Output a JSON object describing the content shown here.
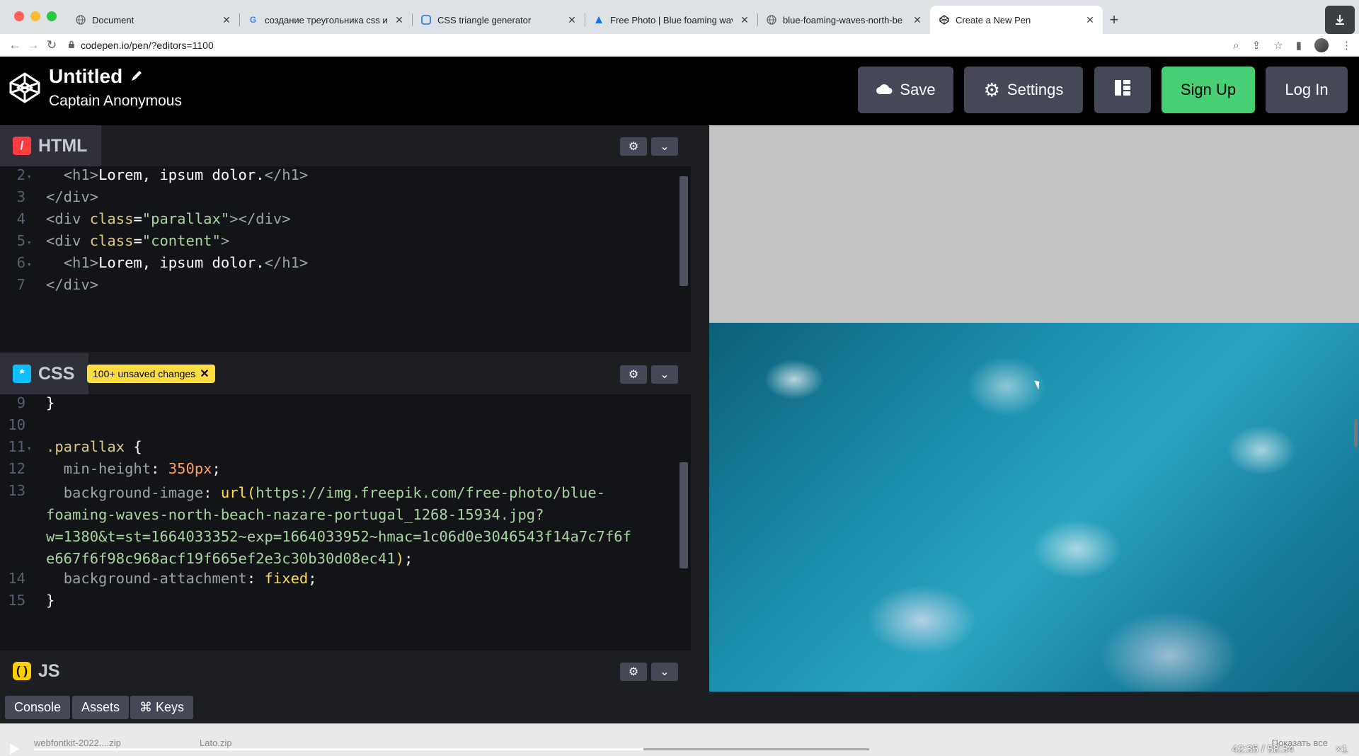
{
  "browser": {
    "tabs": [
      {
        "title": "Document",
        "favicon": "globe-icon",
        "active": false
      },
      {
        "title": "создание треугольника css и",
        "favicon": "google-icon",
        "active": false
      },
      {
        "title": "CSS triangle generator",
        "favicon": "generator-icon",
        "active": false
      },
      {
        "title": "Free Photo | Blue foaming wave",
        "favicon": "freepik-icon",
        "active": false
      },
      {
        "title": "blue-foaming-waves-north-be",
        "favicon": "globe-icon",
        "active": false
      },
      {
        "title": "Create a New Pen",
        "favicon": "codepen-icon",
        "active": true
      }
    ],
    "url": "codepen.io/pen/?editors=1100"
  },
  "header": {
    "title": "Untitled",
    "user": "Captain Anonymous",
    "buttons": {
      "save": "Save",
      "settings": "Settings",
      "signup": "Sign Up",
      "login": "Log In"
    }
  },
  "html_editor": {
    "label": "HTML",
    "lines": [
      {
        "n": "2",
        "fold": true
      },
      {
        "n": "3",
        "fold": false
      },
      {
        "n": "4",
        "fold": false
      },
      {
        "n": "5",
        "fold": true
      },
      {
        "n": "6",
        "fold": true
      },
      {
        "n": "7",
        "fold": false
      }
    ]
  },
  "css_editor": {
    "label": "CSS",
    "badge": "100+ unsaved changes",
    "lines": [
      {
        "n": "9"
      },
      {
        "n": "10"
      },
      {
        "n": "11"
      },
      {
        "n": "12"
      },
      {
        "n": "13"
      },
      {
        "n": "14"
      },
      {
        "n": "15"
      }
    ]
  },
  "js_editor": {
    "label": "JS"
  },
  "footer": {
    "console": "Console",
    "assets": "Assets",
    "keys": "⌘ Keys"
  },
  "video": {
    "downloads": [
      "webfontkit-2022....zip",
      "Lato.zip"
    ],
    "time": "42:35 / 58:34",
    "speed": "×1",
    "show_all": "Показать все",
    "progress": 0.73
  },
  "colors": {
    "signup": "#47cf73",
    "button": "#444857",
    "badge": "#ffdd40",
    "preview_bg": "#c4c4c4"
  }
}
